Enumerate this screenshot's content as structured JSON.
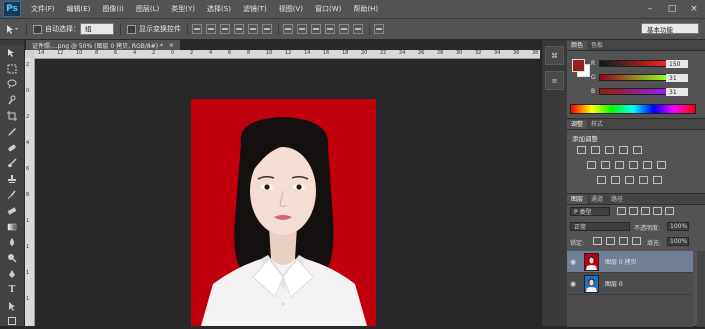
{
  "app": {
    "logo": "Ps"
  },
  "menu": [
    "文件(F)",
    "编辑(E)",
    "图像(I)",
    "图层(L)",
    "类型(Y)",
    "选择(S)",
    "滤镜(T)",
    "视图(V)",
    "窗口(W)",
    "帮助(H)"
  ],
  "window_controls": [
    "–",
    "□",
    "×"
  ],
  "options": {
    "auto_select_label": "自动选择：",
    "auto_select_value": "组",
    "show_transform_label": "显示变换控件",
    "workspace": "基本功能"
  },
  "document": {
    "tab_title": "证件照....png @ 50% (图层 0 拷贝, RGB/8#) *",
    "close": "×"
  },
  "ruler": {
    "h_ticks": [
      "14",
      "12",
      "10",
      "8",
      "6",
      "4",
      "2",
      "0",
      "2",
      "4",
      "6",
      "8",
      "10",
      "12",
      "14",
      "16",
      "18",
      "20",
      "22",
      "24",
      "26",
      "28",
      "30",
      "32",
      "34",
      "36",
      "38"
    ]
  },
  "color_panel": {
    "tabs": [
      "颜色",
      "色板"
    ],
    "channels": [
      {
        "label": "R",
        "value": "150"
      },
      {
        "label": "G",
        "value": "31"
      },
      {
        "label": "B",
        "value": "31"
      }
    ],
    "foreground": "#961f1f"
  },
  "adjust_panel": {
    "tabs": [
      "调整",
      "样式"
    ],
    "heading": "添加调整"
  },
  "layers_panel": {
    "tabs": [
      "图层",
      "通道",
      "路径"
    ],
    "filter": "P 类型",
    "blend_mode": "正常",
    "opacity_label": "不透明度:",
    "opacity_value": "100%",
    "lock_label": "锁定:",
    "fill_label": "填充:",
    "fill_value": "100%",
    "layers": [
      {
        "name": "图层 0 拷贝",
        "selected": true,
        "bg": "#c1000d"
      },
      {
        "name": "图层 0",
        "selected": false,
        "bg": "#1f6fc4"
      }
    ]
  },
  "toolbar_icons": [
    "move-icon",
    "marquee-icon",
    "lasso-icon",
    "quick-select-icon",
    "crop-icon",
    "eyedropper-icon",
    "healing-icon",
    "brush-icon",
    "clone-stamp-icon",
    "history-brush-icon",
    "eraser-icon",
    "gradient-icon",
    "blur-icon",
    "dodge-icon",
    "pen-icon",
    "type-icon",
    "path-select-icon",
    "shape-icon"
  ]
}
